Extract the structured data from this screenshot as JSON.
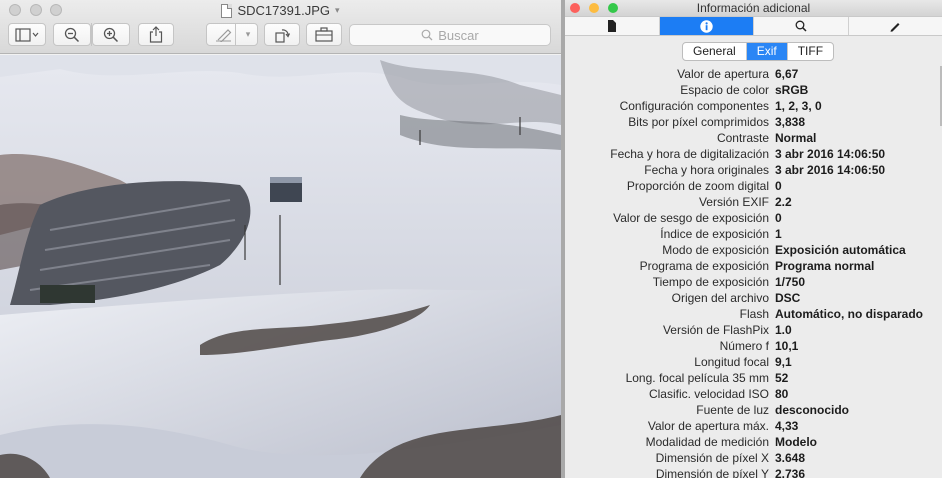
{
  "preview": {
    "filename": "SDC17391.JPG",
    "search_placeholder": "Buscar"
  },
  "info_panel": {
    "title": "Información adicional",
    "tabs": [
      {
        "icon": "document-icon"
      },
      {
        "icon": "info-icon",
        "active": true
      },
      {
        "icon": "search-icon"
      },
      {
        "icon": "pencil-icon"
      }
    ],
    "segments": [
      {
        "label": "General"
      },
      {
        "label": "Exif",
        "active": true
      },
      {
        "label": "TIFF"
      }
    ],
    "exif_rows": [
      {
        "label": "Valor de apertura",
        "value": "6,67"
      },
      {
        "label": "Espacio de color",
        "value": "sRGB"
      },
      {
        "label": "Configuración componentes",
        "value": "1, 2, 3, 0"
      },
      {
        "label": "Bits por píxel comprimidos",
        "value": "3,838"
      },
      {
        "label": "Contraste",
        "value": "Normal"
      },
      {
        "label": "Fecha y hora de digitalización",
        "value": "3 abr 2016 14:06:50"
      },
      {
        "label": "Fecha y hora originales",
        "value": "3 abr 2016 14:06:50"
      },
      {
        "label": "Proporción de zoom digital",
        "value": "0"
      },
      {
        "label": "Versión EXIF",
        "value": "2.2"
      },
      {
        "label": "Valor de sesgo de exposición",
        "value": "0"
      },
      {
        "label": "Índice de exposición",
        "value": "1"
      },
      {
        "label": "Modo de exposición",
        "value": "Exposición automática"
      },
      {
        "label": "Programa de exposición",
        "value": "Programa normal"
      },
      {
        "label": "Tiempo de exposición",
        "value": "1/750"
      },
      {
        "label": "Origen del archivo",
        "value": "DSC"
      },
      {
        "label": "Flash",
        "value": "Automático, no disparado"
      },
      {
        "label": "Versión de FlashPix",
        "value": "1.0"
      },
      {
        "label": "Número f",
        "value": "10,1"
      },
      {
        "label": "Longitud focal",
        "value": "9,1"
      },
      {
        "label": "Long. focal película 35 mm",
        "value": "52"
      },
      {
        "label": "Clasific. velocidad ISO",
        "value": "80"
      },
      {
        "label": "Fuente de luz",
        "value": "desconocido"
      },
      {
        "label": "Valor de apertura máx.",
        "value": "4,33"
      },
      {
        "label": "Modalidad de medición",
        "value": "Modelo"
      },
      {
        "label": "Dimensión de píxel X",
        "value": "3.648"
      },
      {
        "label": "Dimensión de píxel Y",
        "value": "2.736"
      }
    ]
  },
  "colors": {
    "accent": "#1c7df4",
    "close": "#fc605c",
    "minimize": "#fdbc40",
    "zoom": "#34c84a"
  }
}
